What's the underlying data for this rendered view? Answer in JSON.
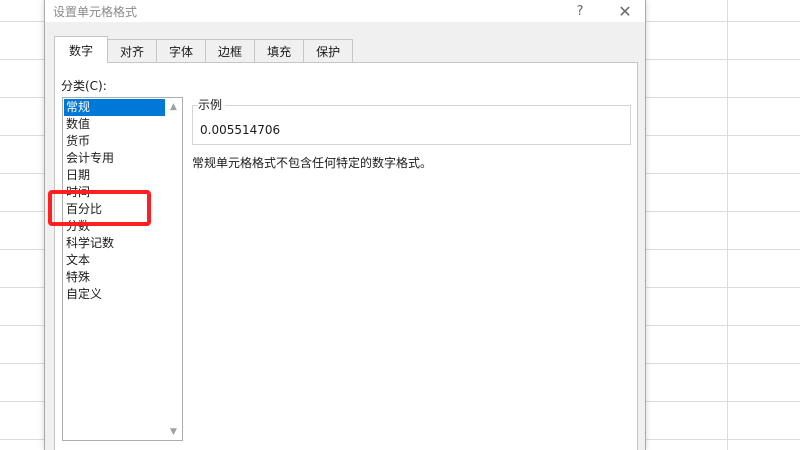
{
  "dialog": {
    "title": "设置单元格格式",
    "help_glyph": "?",
    "close_glyph": "✕"
  },
  "tabs": [
    {
      "label": "数字",
      "active": true
    },
    {
      "label": "对齐"
    },
    {
      "label": "字体"
    },
    {
      "label": "边框"
    },
    {
      "label": "填充"
    },
    {
      "label": "保护"
    }
  ],
  "category": {
    "label": "分类(C):",
    "items": [
      "常规",
      "数值",
      "货币",
      "会计专用",
      "日期",
      "时间",
      "百分比",
      "分数",
      "科学记数",
      "文本",
      "特殊",
      "自定义"
    ],
    "selected": "常规",
    "highlighted": "百分比"
  },
  "sample": {
    "legend": "示例",
    "value": "0.005514706"
  },
  "description": "常规单元格格式不包含任何特定的数字格式。",
  "colors": {
    "selection": "#0078d7",
    "highlight_box": "#ff1f1f"
  },
  "icons": {
    "scroll_up": "scroll-up-arrow-icon",
    "scroll_down": "scroll-down-arrow-icon",
    "help": "help-icon",
    "close": "close-icon"
  }
}
